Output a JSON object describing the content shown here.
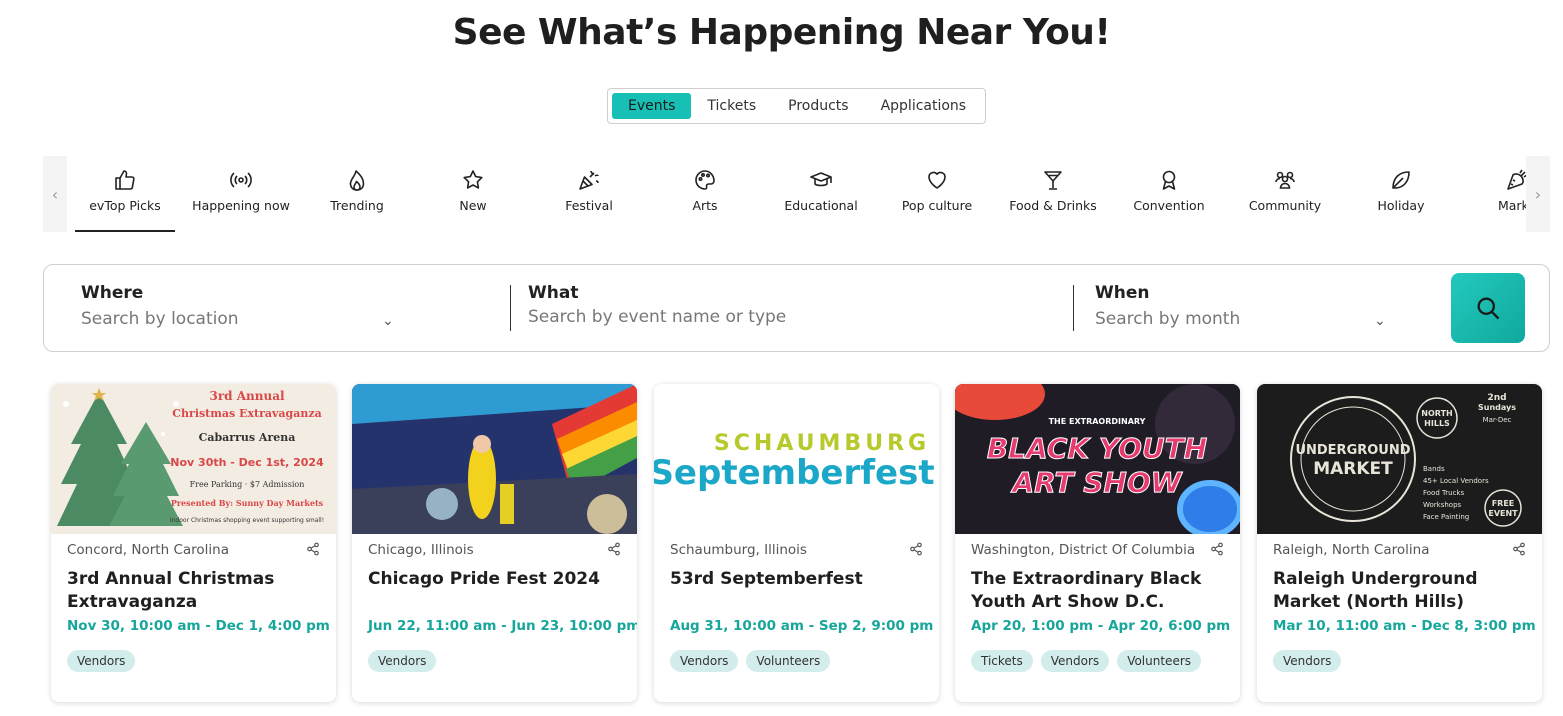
{
  "page": {
    "title": "See What’s Happening Near You!"
  },
  "type_tabs": [
    {
      "label": "Events",
      "active": true
    },
    {
      "label": "Tickets",
      "active": false
    },
    {
      "label": "Products",
      "active": false
    },
    {
      "label": "Applications",
      "active": false
    }
  ],
  "categories": [
    {
      "label": "evTop Picks",
      "icon": "thumbs-up-icon",
      "active": true
    },
    {
      "label": "Happening now",
      "icon": "broadcast-icon"
    },
    {
      "label": "Trending",
      "icon": "flame-icon"
    },
    {
      "label": "New",
      "icon": "star-icon"
    },
    {
      "label": "Festival",
      "icon": "party-popper-icon"
    },
    {
      "label": "Arts",
      "icon": "palette-icon"
    },
    {
      "label": "Educational",
      "icon": "graduation-cap-icon"
    },
    {
      "label": "Pop culture",
      "icon": "heart-icon"
    },
    {
      "label": "Food & Drinks",
      "icon": "cocktail-icon"
    },
    {
      "label": "Convention",
      "icon": "award-ribbon-icon"
    },
    {
      "label": "Community",
      "icon": "people-group-icon"
    },
    {
      "label": "Holiday",
      "icon": "leaf-icon"
    },
    {
      "label": "Marke",
      "icon": "carrot-icon"
    }
  ],
  "search": {
    "where_label": "Where",
    "where_placeholder": "Search by location",
    "what_label": "What",
    "what_placeholder": "Search by event name or type",
    "when_label": "When",
    "when_placeholder": "Search by month"
  },
  "events": [
    {
      "location": "Concord, North Carolina",
      "title": "3rd Annual Christmas Extravaganza",
      "dates": "Nov 30, 10:00 am - Dec 1, 4:00 pm",
      "tags": [
        "Vendors"
      ],
      "poster": {
        "l1": "3rd Annual",
        "l2": "Christmas Extravaganza",
        "l3": "Cabarrus Arena",
        "l4": "Nov 30th - Dec 1st, 2024",
        "l5": "Free Parking · $7 Admission",
        "l6": "Presented By: Sunny Day Markets",
        "l7": "Indoor Christmas shopping event supporting small!"
      }
    },
    {
      "location": "Chicago, Illinois",
      "title": "Chicago Pride Fest 2024",
      "dates": "Jun 22, 11:00 am - Jun 23, 10:00 pm",
      "tags": [
        "Vendors"
      ]
    },
    {
      "location": "Schaumburg, Illinois",
      "title": "53rd Septemberfest",
      "dates": "Aug 31, 10:00 am - Sep 2, 9:00 pm",
      "tags": [
        "Vendors",
        "Volunteers"
      ],
      "poster": {
        "l1": "SCHAUMBURG",
        "l2": "Septemberfest"
      }
    },
    {
      "location": "Washington, District Of Columbia",
      "title": "The Extraordinary Black Youth Art Show D.C.",
      "dates": "Apr 20, 1:00 pm - Apr 20, 6:00 pm",
      "tags": [
        "Tickets",
        "Vendors",
        "Volunteers"
      ],
      "poster": {
        "l1": "THE EXTRAORDINARY",
        "l2": "BLACK YOUTH",
        "l3": "ART SHOW"
      }
    },
    {
      "location": "Raleigh, North Carolina",
      "title": "Raleigh Underground Market (North Hills)",
      "dates": "Mar 10, 11:00 am - Dec 8, 3:00 pm",
      "tags": [
        "Vendors"
      ],
      "poster": {
        "l1": "UNDERGROUND",
        "l2": "MARKET",
        "l3": "NORTH",
        "l4": "HILLS",
        "l5": "2nd",
        "l6": "Sundays",
        "l7": "Mar-Dec",
        "l8": "Bands",
        "l9": "45+ Local Vendors",
        "l10": "Food Trucks",
        "l11": "Workshops",
        "l12": "Face Painting",
        "l13": "FREE",
        "l14": "EVENT"
      }
    }
  ],
  "colors": {
    "accent": "#17bfb4",
    "date_text": "#17a69c",
    "tag_bg": "#d3ecec"
  }
}
